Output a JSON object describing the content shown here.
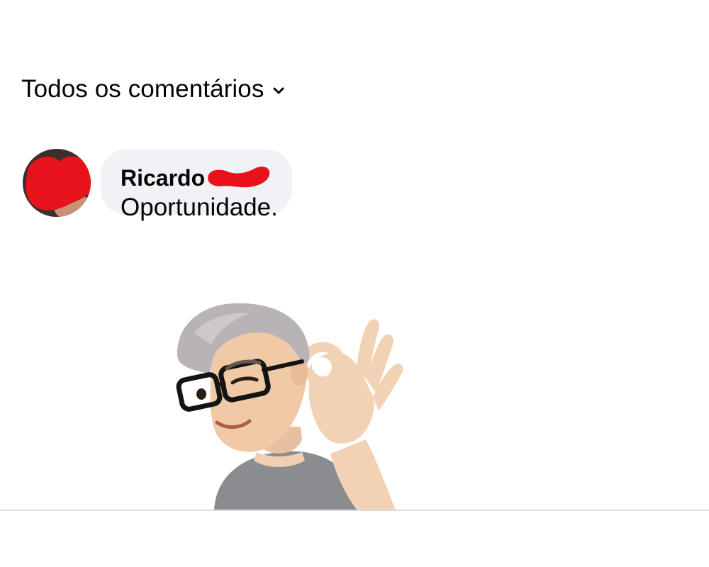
{
  "comments_header": {
    "sort_label": "Todos os comentários",
    "sort_icon": "chevron-down-icon"
  },
  "comment": {
    "author_first_name": "Ricardo",
    "text": "Oportunidade.",
    "avatar": "redacted-avatar",
    "redaction_color": "#e8121b"
  },
  "sticker": {
    "type": "avatar-sticker-ok-gesture"
  },
  "colors": {
    "bubble_bg": "#f0f2f5",
    "text": "#050505",
    "divider": "#dadde1"
  }
}
